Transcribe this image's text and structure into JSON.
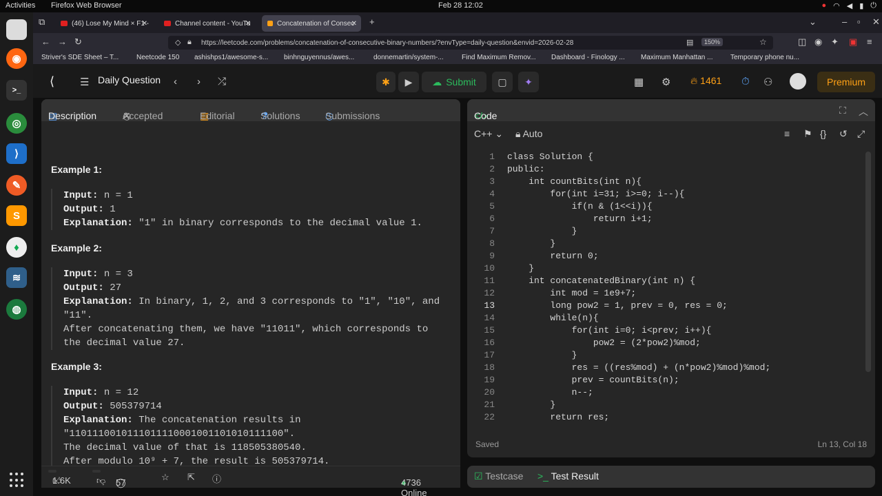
{
  "system": {
    "activities": "Activities",
    "browser_label": "Firefox Web Browser",
    "clock": "Feb 28  12:02"
  },
  "browser": {
    "tabs": [
      {
        "label": "(46) Lose My Mind × F1 -",
        "color": "#e02020"
      },
      {
        "label": "Channel content - YouTu",
        "color": "#e02020"
      },
      {
        "label": "Concatenation of Consec",
        "color": "#ffa116"
      }
    ],
    "url": "https://leetcode.com/problems/concatenation-of-consecutive-binary-numbers/?envType=daily-question&envid=2026-02-28",
    "zoom": "150%",
    "bookmarks": [
      "Striver's SDE Sheet – T...",
      "Neetcode 150",
      "ashishps1/awesome-s...",
      "binhnguyennus/awes...",
      "donnemartin/system-...",
      "Find Maximum Remov...",
      "Dashboard - Finology ...",
      "Maximum Manhattan ...",
      "Temporary phone nu..."
    ]
  },
  "header": {
    "daily_question": "Daily Question",
    "submit": "Submit",
    "streak": "1461",
    "premium": "Premium"
  },
  "left_tabs": {
    "description": "Description",
    "accepted": "Accepted",
    "editorial": "Editorial",
    "solutions": "Solutions",
    "submissions": "Submissions"
  },
  "examples": [
    {
      "title": "Example 1:",
      "input_label": "Input:",
      "input": " n = 1",
      "output_label": "Output:",
      "output": " 1",
      "explanation_label": "Explanation:",
      "explanation": " \"1\" in binary corresponds to the decimal value 1."
    },
    {
      "title": "Example 2:",
      "input_label": "Input:",
      "input": " n = 3",
      "output_label": "Output:",
      "output": " 27",
      "explanation_label": "Explanation:",
      "explanation": " In binary, 1, 2, and 3 corresponds to \"1\", \"10\", and",
      "extra": [
        "\"11\".",
        "After concatenating them, we have \"11011\", which corresponds to",
        "the decimal value 27."
      ]
    },
    {
      "title": "Example 3:",
      "input_label": "Input:",
      "input": " n = 12",
      "output_label": "Output:",
      "output": " 505379714",
      "explanation_label": "Explanation:",
      "explanation": " The concatenation results in",
      "extra": [
        "\"1101110010111011110001001101010111100\".",
        "The decimal value of that is 118505380540.",
        "After modulo 10⁹ + 7, the result is 505379714."
      ]
    }
  ],
  "desc_footer": {
    "likes": "1.6K",
    "comments": "57",
    "online": "4736 Online"
  },
  "code_panel": {
    "title": "Code",
    "language": "C++",
    "mode": "Auto",
    "saved": "Saved",
    "cursor": "Ln 13, Col 18",
    "lines": [
      "class Solution {",
      "public:",
      "    int countBits(int n){",
      "        for(int i=31; i>=0; i--){",
      "            if(n & (1<<i)){",
      "                return i+1;",
      "            }",
      "        }",
      "        return 0;",
      "    }",
      "    int concatenatedBinary(int n) {",
      "        int mod = 1e9+7;",
      "        long pow2 = 1, prev = 0, res = 0;",
      "        while(n){",
      "            for(int i=0; i<prev; i++){",
      "                pow2 = (2*pow2)%mod;",
      "            }",
      "            res = ((res%mod) + (n*pow2)%mod)%mod;",
      "            prev = countBits(n);",
      "            n--;",
      "        }",
      "        return res;"
    ]
  },
  "bottom_tabs": {
    "testcase": "Testcase",
    "test_result": "Test Result"
  }
}
